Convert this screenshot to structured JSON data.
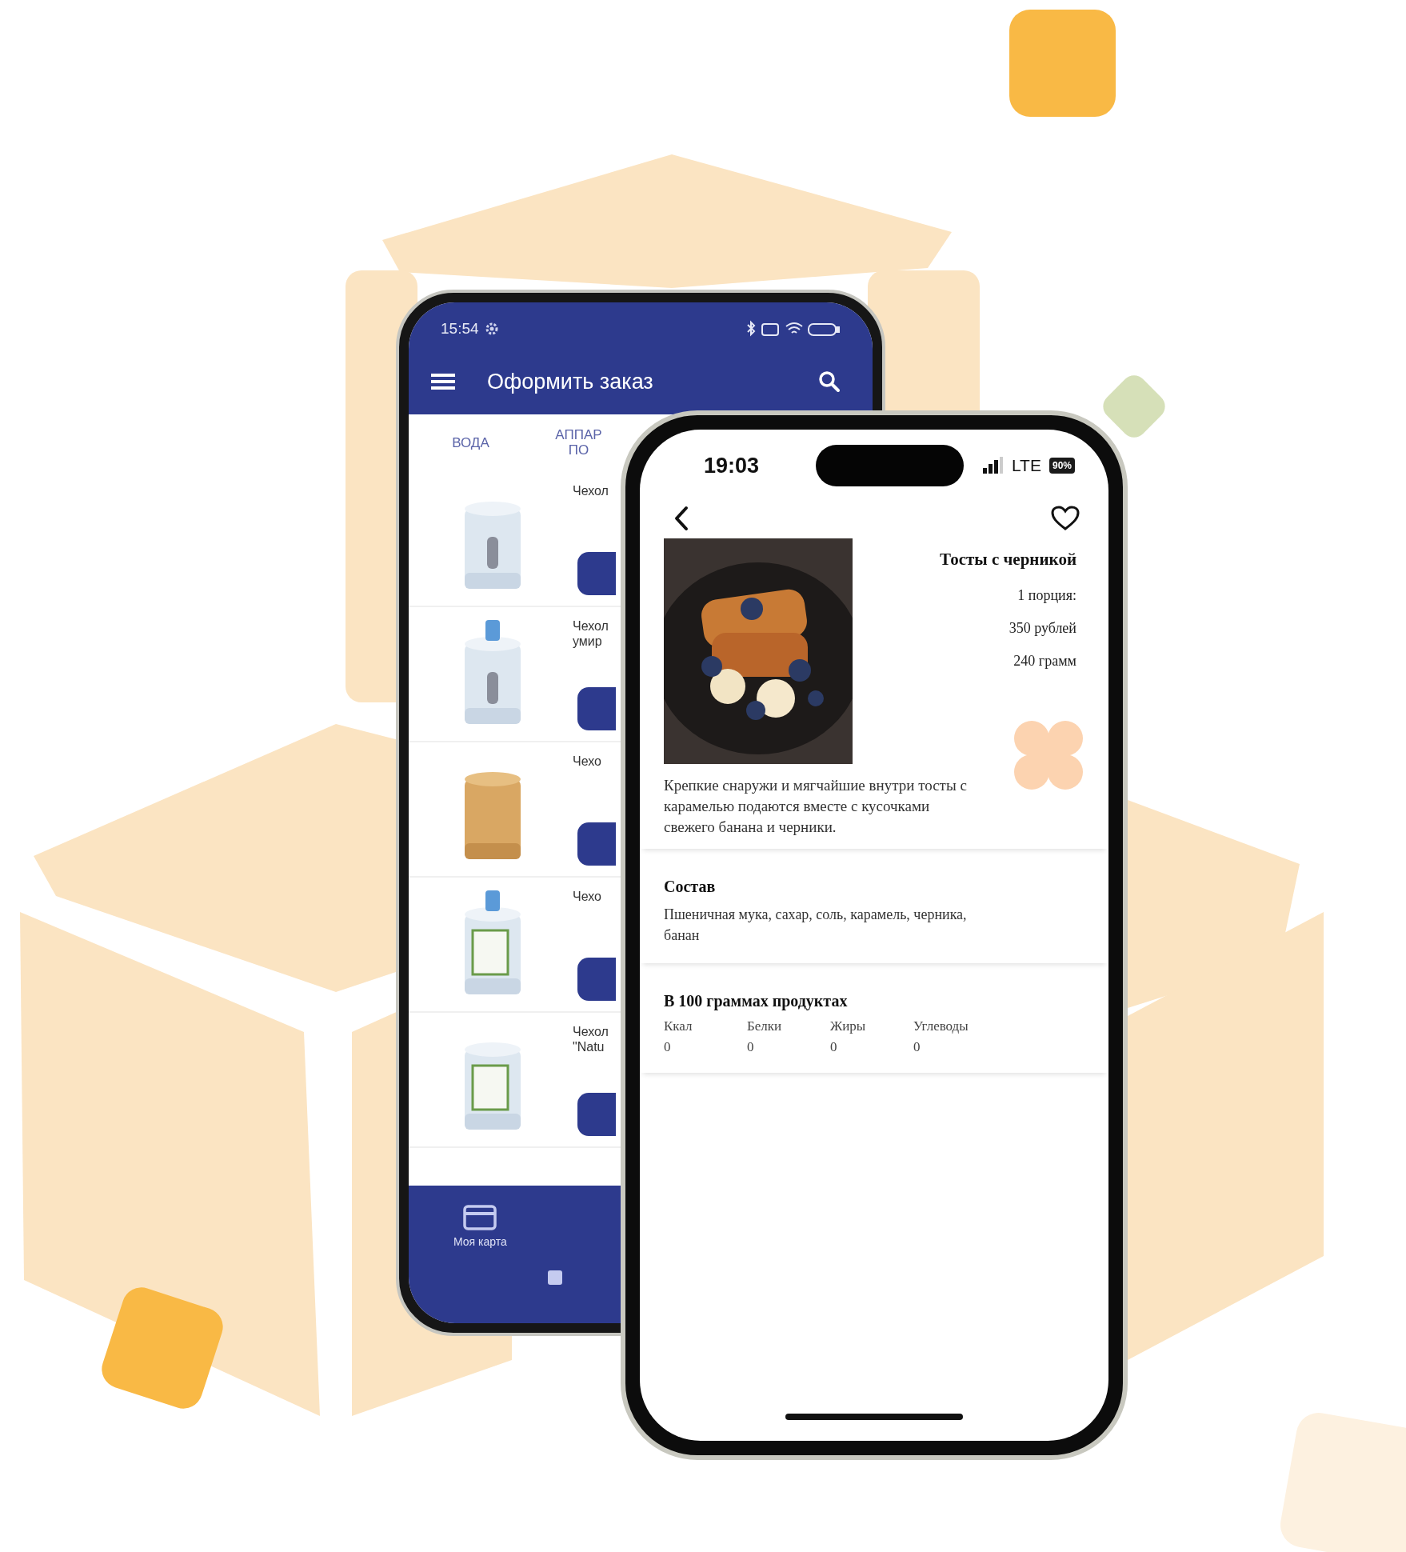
{
  "back_phone": {
    "status_bar": {
      "time": "15:54"
    },
    "app_bar": {
      "title": "Оформить заказ"
    },
    "tabs": [
      {
        "label": "ВОДА"
      },
      {
        "label": "АППАР\nПО"
      }
    ],
    "products": [
      {
        "title": "Чехол",
        "kind": "picture"
      },
      {
        "title": "Чехол\nумир",
        "kind": "picture"
      },
      {
        "title": "Чехо",
        "kind": "picture"
      },
      {
        "title": "Чехо",
        "kind": "picture"
      },
      {
        "title": "Чехол\n\"Natu",
        "kind": "picture"
      }
    ],
    "bottom_nav": [
      {
        "label": "Моя карта"
      }
    ]
  },
  "front_phone": {
    "status_bar": {
      "time": "19:03",
      "network": "LTE",
      "battery": "90%"
    },
    "dish": {
      "title": "Тосты с черникой",
      "portion": "1 порция:",
      "price": "350 рублей",
      "weight": "240 грамм",
      "description": "Крепкие снаружи и мягчайшие внутри тосты с карамелью подаются вместе с кусочками свежего банана и черники."
    },
    "ingredients": {
      "heading": "Состав",
      "text": "Пшеничная мука, сахар, соль, карамель, черника, банан"
    },
    "nutrition": {
      "heading": "В 100 граммах продуктах",
      "items": [
        {
          "label": "Ккал",
          "value": "0"
        },
        {
          "label": "Белки",
          "value": "0"
        },
        {
          "label": "Жиры",
          "value": "0"
        },
        {
          "label": "Углеводы",
          "value": "0"
        }
      ]
    }
  }
}
